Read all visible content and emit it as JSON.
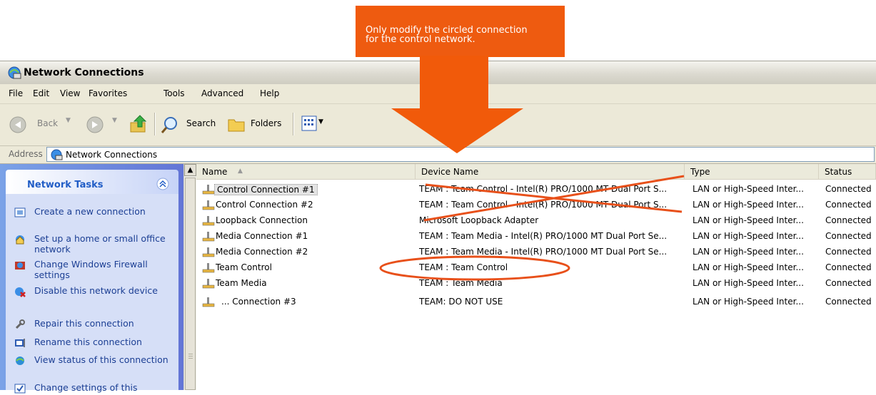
{
  "annotation": {
    "line1": "Only modify the circled connection",
    "line2": "for the control network.",
    "color": "#ee5b10"
  },
  "window": {
    "title": "Network Connections"
  },
  "menu": [
    "File",
    "Edit",
    "View",
    "Favorites",
    "Tools",
    "Advanced",
    "Help"
  ],
  "toolbar": {
    "back": "Back",
    "search": "Search",
    "folders": "Folders"
  },
  "address": {
    "label": "Address",
    "value": "Network Connections"
  },
  "tasks": {
    "title": "Network Tasks",
    "items": [
      "Create a new connection",
      "Set up a home or small office network",
      "Change Windows Firewall settings",
      "Disable this network device",
      "Repair this connection",
      "Rename this connection",
      "View status of this connection",
      "Change settings of this"
    ]
  },
  "columns": {
    "name": "Name",
    "device": "Device Name",
    "type": "Type",
    "status": "Status"
  },
  "rows": [
    {
      "name": "Control Connection #1",
      "device": "TEAM : Team Control - Intel(R) PRO/1000 MT Dual Port S...",
      "type": "LAN or High-Speed Inter...",
      "status": "Connected"
    },
    {
      "name": "Control Connection #2",
      "device": "TEAM : Team Control - Intel(R) PRO/1000 MT Dual Port S...",
      "type": "LAN or High-Speed Inter...",
      "status": "Connected"
    },
    {
      "name": "Loopback Connection",
      "device": "Microsoft Loopback Adapter",
      "type": "LAN or High-Speed Inter...",
      "status": "Connected"
    },
    {
      "name": "Media Connection #1",
      "device": "TEAM : Team Media - Intel(R) PRO/1000 MT Dual Port Se...",
      "type": "LAN or High-Speed Inter...",
      "status": "Connected"
    },
    {
      "name": "Media Connection #2",
      "device": "TEAM : Team Media - Intel(R) PRO/1000 MT Dual Port Se...",
      "type": "LAN or High-Speed Inter...",
      "status": "Connected"
    },
    {
      "name": "Team Control",
      "device": "TEAM : Team Control",
      "type": "LAN or High-Speed Inter...",
      "status": "Connected"
    },
    {
      "name": "Team Media",
      "device": "TEAM : Team Media",
      "type": "LAN or High-Speed Inter...",
      "status": "Connected"
    },
    {
      "name": "... Connection #3",
      "device": "TEAM: DO NOT USE",
      "type": "LAN or High-Speed Inter...",
      "status": "Connected"
    }
  ]
}
